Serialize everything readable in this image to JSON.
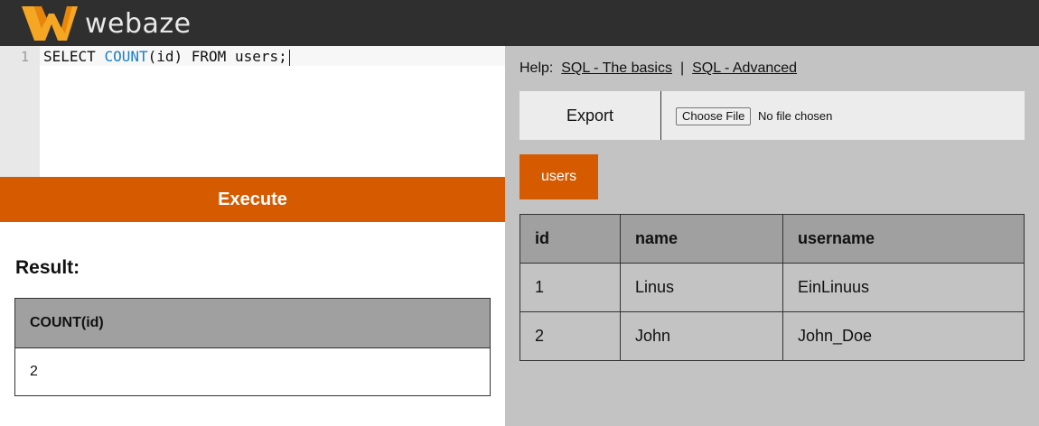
{
  "brand": {
    "name": "webaze",
    "logo_colors": [
      "#f5a623",
      "#e8860c"
    ]
  },
  "editor": {
    "line_number": "1",
    "code": {
      "part1": "SELECT ",
      "keyword": "COUNT",
      "part2": "(id) FROM users;"
    },
    "keyword_color": "#1a7fc6"
  },
  "execute_label": "Execute",
  "result": {
    "title": "Result:",
    "columns": [
      "COUNT(id)"
    ],
    "rows": [
      [
        "2"
      ]
    ]
  },
  "help": {
    "label": "Help:",
    "links": [
      "SQL - The basics",
      "SQL - Advanced"
    ],
    "separator": "|"
  },
  "toolbar": {
    "export_label": "Export",
    "file_button_label": "Choose File",
    "file_status": "No file chosen"
  },
  "tables": {
    "tabs": [
      "users"
    ],
    "active_tab": "users"
  },
  "data_table": {
    "columns": [
      "id",
      "name",
      "username"
    ],
    "rows": [
      [
        "1",
        "Linus",
        "EinLinuus"
      ],
      [
        "2",
        "John",
        "John_Doe"
      ]
    ]
  },
  "colors": {
    "accent": "#d65b00",
    "header_bg": "#2f2f2f",
    "panel_bg": "#c3c3c3"
  }
}
